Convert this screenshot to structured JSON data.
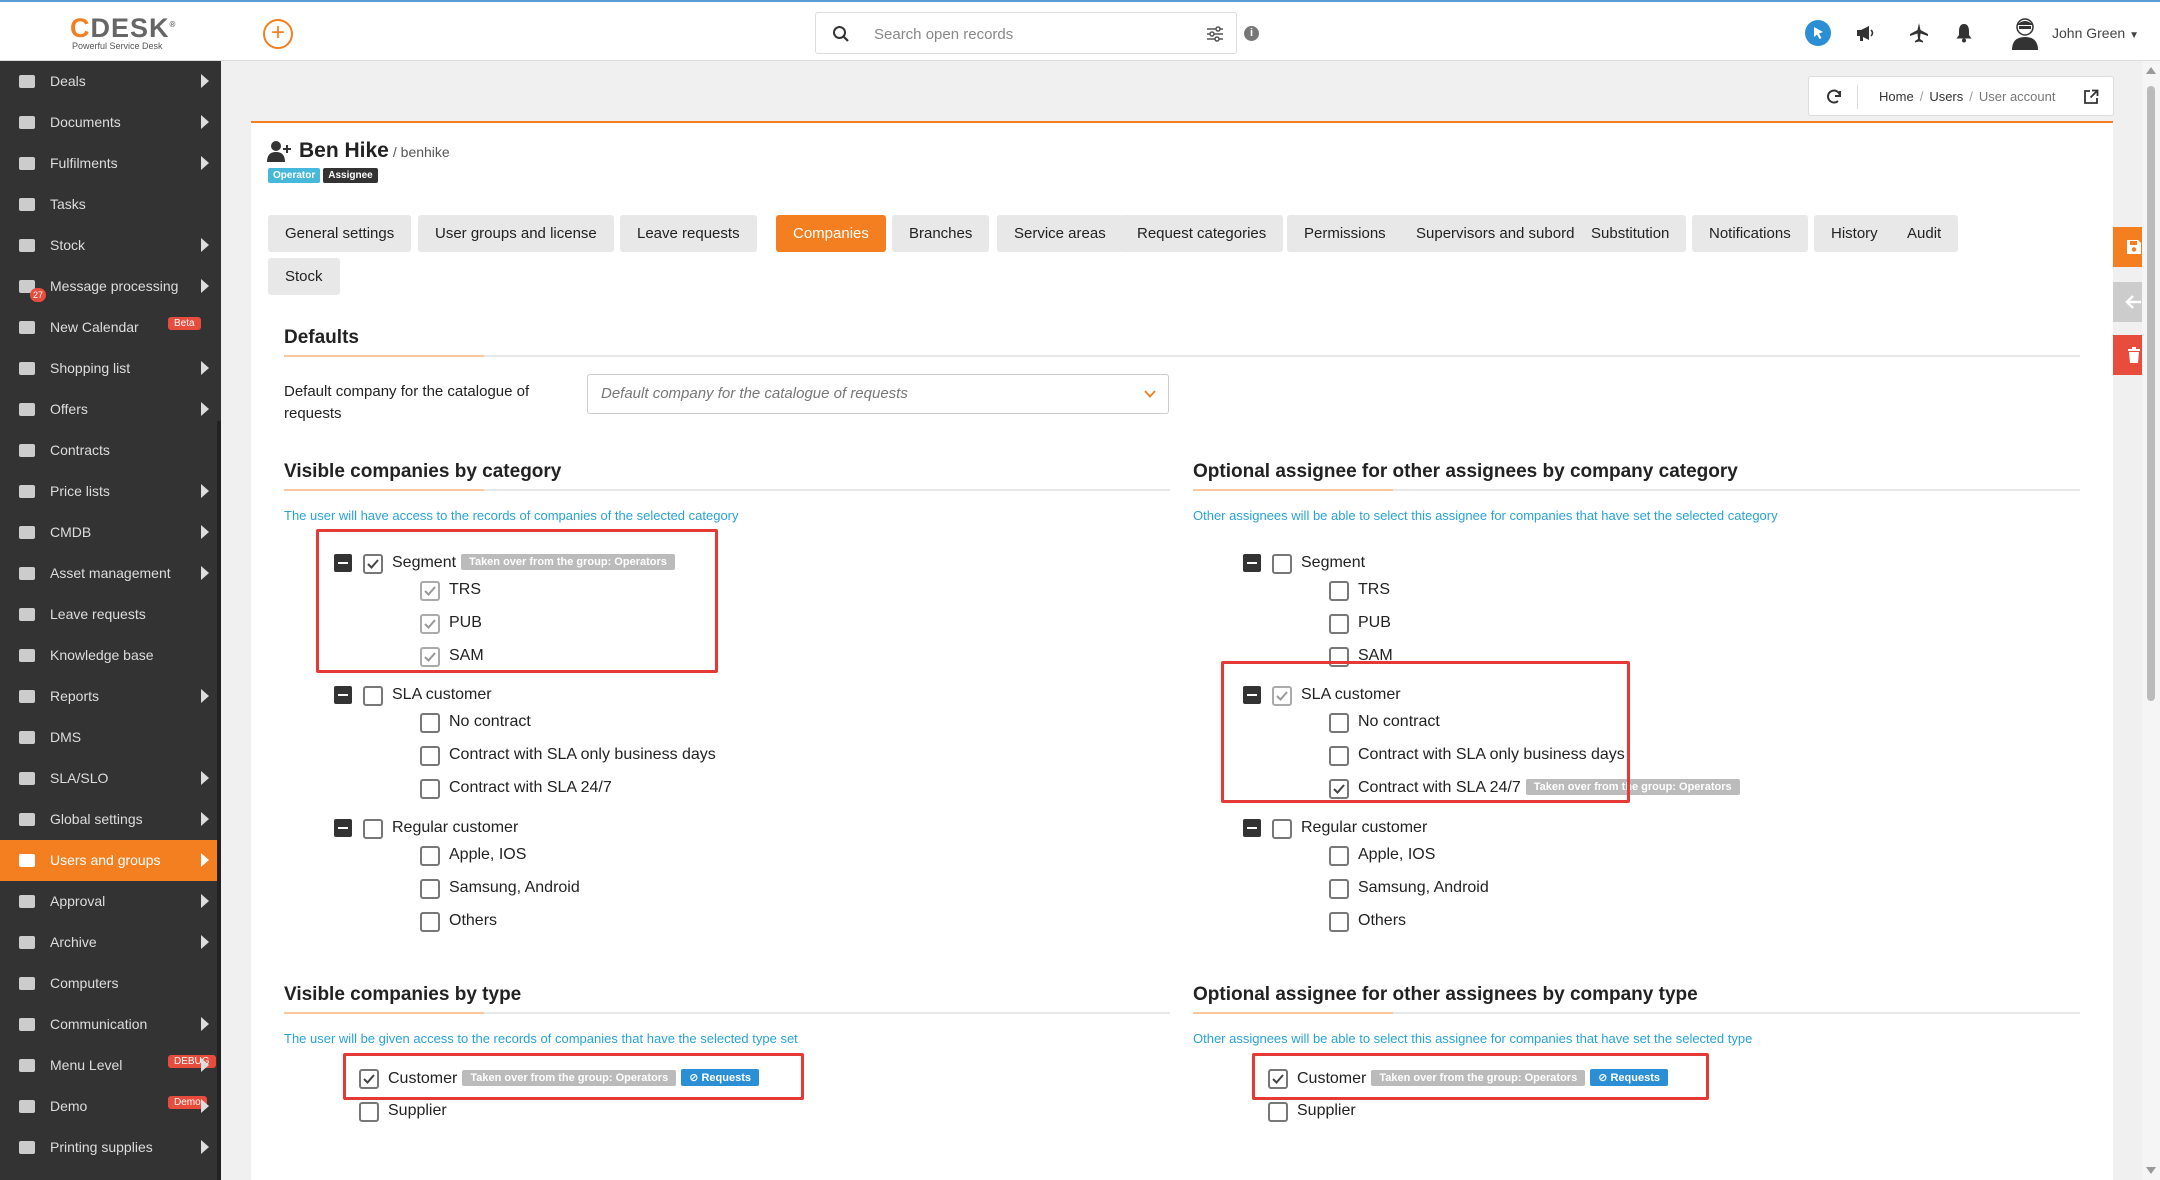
{
  "topbar": {
    "logo_text": "CDESK",
    "logo_subtitle": "Powerful Service Desk",
    "search_placeholder": "Search open records",
    "user_name": "John Green"
  },
  "sidebar": {
    "items": [
      {
        "label": "Deals",
        "icon": "briefcase-icon",
        "arrow": true
      },
      {
        "label": "Documents",
        "icon": "documents-icon",
        "arrow": true
      },
      {
        "label": "Fulfilments",
        "icon": "list-icon",
        "arrow": true
      },
      {
        "label": "Tasks",
        "icon": "tasks-icon",
        "arrow": false
      },
      {
        "label": "Stock",
        "icon": "stock-icon",
        "arrow": true
      },
      {
        "label": "Message processing",
        "icon": "envelope-icon",
        "arrow": true,
        "count": "27"
      },
      {
        "label": "New Calendar",
        "icon": "calendar-icon",
        "arrow": false,
        "badge": "Beta"
      },
      {
        "label": "Shopping list",
        "icon": "cart-icon",
        "arrow": true
      },
      {
        "label": "Offers",
        "icon": "tag-icon",
        "arrow": true
      },
      {
        "label": "Contracts",
        "icon": "file-icon",
        "arrow": false
      },
      {
        "label": "Price lists",
        "icon": "money-icon",
        "arrow": true
      },
      {
        "label": "CMDB",
        "icon": "folder-icon",
        "arrow": true
      },
      {
        "label": "Asset management",
        "icon": "box-icon",
        "arrow": true
      },
      {
        "label": "Leave requests",
        "icon": "plane-icon",
        "arrow": false
      },
      {
        "label": "Knowledge base",
        "icon": "book-icon",
        "arrow": false
      },
      {
        "label": "Reports",
        "icon": "bar-chart-icon",
        "arrow": true
      },
      {
        "label": "DMS",
        "icon": "database-icon",
        "arrow": false
      },
      {
        "label": "SLA/SLO",
        "icon": "wrench-icon",
        "arrow": true
      },
      {
        "label": "Global settings",
        "icon": "cogs-icon",
        "arrow": true
      },
      {
        "label": "Users and groups",
        "icon": "users-icon",
        "arrow": true,
        "active": true
      },
      {
        "label": "Approval",
        "icon": "user-icon",
        "arrow": true
      },
      {
        "label": "Archive",
        "icon": "archive-icon",
        "arrow": true
      },
      {
        "label": "Computers",
        "icon": "laptop-icon",
        "arrow": false
      },
      {
        "label": "Communication",
        "icon": "exchange-icon",
        "arrow": true
      },
      {
        "label": "Menu Level",
        "icon": "menu-icon",
        "arrow": true,
        "badge": "DEBUG"
      },
      {
        "label": "Demo",
        "icon": "flask-icon",
        "arrow": true,
        "badge": "Demo"
      },
      {
        "label": "Printing supplies",
        "icon": "printer-icon",
        "arrow": true
      }
    ],
    "accent_color": "#f47f20"
  },
  "breadcrumb": {
    "home": "Home",
    "users": "Users",
    "current": "User account"
  },
  "user": {
    "name": "Ben Hike",
    "login": "/ benhike",
    "badges": [
      "Operator",
      "Assignee"
    ]
  },
  "tabs": [
    {
      "label": "General settings"
    },
    {
      "label": "User groups and license"
    },
    {
      "label": "Leave requests"
    },
    {
      "label": "Companies",
      "active": true
    },
    {
      "label": "Branches"
    },
    {
      "label": "Service areas"
    },
    {
      "label": "Request categories"
    },
    {
      "label": "Permissions"
    },
    {
      "label": "Supervisors and subordinates"
    },
    {
      "label": "Substitution"
    },
    {
      "label": "Notifications"
    },
    {
      "label": "History"
    },
    {
      "label": "Audit"
    },
    {
      "label": "Stock"
    }
  ],
  "defaults": {
    "title": "Defaults",
    "label": "Default company for the catalogue of requests",
    "placeholder": "Default company for the catalogue of requests"
  },
  "visible_by_category": {
    "title": "Visible companies by category",
    "hint": "The user will have access to the records of companies of the selected category",
    "groups": [
      {
        "label": "Segment",
        "checked": true,
        "taken": "Taken over from the group: Operators",
        "children": [
          {
            "label": "TRS",
            "checked": true
          },
          {
            "label": "PUB",
            "checked": true
          },
          {
            "label": "SAM",
            "checked": true
          }
        ]
      },
      {
        "label": "SLA customer",
        "checked": false,
        "children": [
          {
            "label": "No contract",
            "checked": false
          },
          {
            "label": "Contract with SLA only business days",
            "checked": false
          },
          {
            "label": "Contract with SLA 24/7",
            "checked": false
          }
        ]
      },
      {
        "label": "Regular customer",
        "checked": false,
        "children": [
          {
            "label": "Apple, IOS",
            "checked": false
          },
          {
            "label": "Samsung, Android",
            "checked": false
          },
          {
            "label": "Others",
            "checked": false
          }
        ]
      }
    ]
  },
  "optional_by_category": {
    "title": "Optional assignee for other assignees by company category",
    "hint": "Other assignees will be able to select this assignee for companies that have set the selected category",
    "groups": [
      {
        "label": "Segment",
        "checked": false,
        "children": [
          {
            "label": "TRS",
            "checked": false
          },
          {
            "label": "PUB",
            "checked": false
          },
          {
            "label": "SAM",
            "checked": false
          }
        ]
      },
      {
        "label": "SLA customer",
        "checked": true,
        "children": [
          {
            "label": "No contract",
            "checked": false
          },
          {
            "label": "Contract with SLA only business days",
            "checked": false
          },
          {
            "label": "Contract with SLA 24/7",
            "checked": true,
            "taken": "Taken over from the group: Operators"
          }
        ]
      },
      {
        "label": "Regular customer",
        "checked": false,
        "children": [
          {
            "label": "Apple, IOS",
            "checked": false
          },
          {
            "label": "Samsung, Android",
            "checked": false
          },
          {
            "label": "Others",
            "checked": false
          }
        ]
      }
    ]
  },
  "visible_by_type": {
    "title": "Visible companies by type",
    "hint": "The user will be given access to the records of companies that have the selected type set",
    "items": [
      {
        "label": "Customer",
        "checked": true,
        "taken": "Taken over from the group: Operators",
        "requests": "Requests"
      },
      {
        "label": "Supplier",
        "checked": false
      }
    ]
  },
  "optional_by_type": {
    "title": "Optional assignee for other assignees by company type",
    "hint": "Other assignees will be able to select this assignee for companies that have set the selected type",
    "items": [
      {
        "label": "Customer",
        "checked": true,
        "taken": "Taken over from the group: Operators",
        "requests": "Requests"
      },
      {
        "label": "Supplier",
        "checked": false
      }
    ]
  }
}
